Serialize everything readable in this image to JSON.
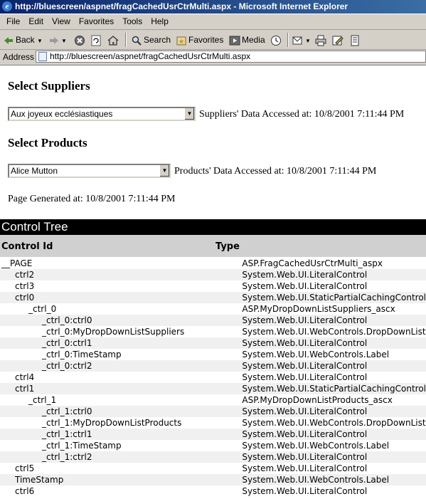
{
  "window": {
    "title": "http://bluescreen/aspnet/fragCachedUsrCtrMulti.aspx - Microsoft Internet Explorer"
  },
  "menu": [
    "File",
    "Edit",
    "View",
    "Favorites",
    "Tools",
    "Help"
  ],
  "toolbar": {
    "back": "Back",
    "search": "Search",
    "favorites": "Favorites",
    "media": "Media"
  },
  "address": {
    "label": "Address",
    "url": "http://bluescreen/aspnet/fragCachedUsrCtrMulti.aspx"
  },
  "page": {
    "suppliers_heading": "Select Suppliers",
    "suppliers_selected": "Aux joyeux ecclésiastiques",
    "suppliers_accessed": "Suppliers' Data Accessed at: 10/8/2001 7:11:44 PM",
    "products_heading": "Select Products",
    "products_selected": "Alice Mutton",
    "products_accessed": "Products' Data Accessed at: 10/8/2001 7:11:44 PM",
    "generated": "Page Generated at: 10/8/2001 7:11:44 PM"
  },
  "trace": {
    "title": "Control Tree",
    "col_id": "Control Id",
    "col_type": "Type",
    "rows": [
      {
        "id": "__PAGE",
        "indent": 0,
        "type": "ASP.FragCachedUsrCtrMulti_aspx"
      },
      {
        "id": "ctrl2",
        "indent": 1,
        "type": "System.Web.UI.LiteralControl"
      },
      {
        "id": "ctrl3",
        "indent": 1,
        "type": "System.Web.UI.LiteralControl"
      },
      {
        "id": "ctrl0",
        "indent": 1,
        "type": "System.Web.UI.StaticPartialCachingControl"
      },
      {
        "id": "_ctrl_0",
        "indent": 2,
        "type": "ASP.MyDropDownListSuppliers_ascx"
      },
      {
        "id": "_ctrl_0:ctrl0",
        "indent": 3,
        "type": "System.Web.UI.LiteralControl"
      },
      {
        "id": "_ctrl_0:MyDropDownListSuppliers",
        "indent": 3,
        "type": "System.Web.UI.WebControls.DropDownList"
      },
      {
        "id": "_ctrl_0:ctrl1",
        "indent": 3,
        "type": "System.Web.UI.LiteralControl"
      },
      {
        "id": "_ctrl_0:TimeStamp",
        "indent": 3,
        "type": "System.Web.UI.WebControls.Label"
      },
      {
        "id": "_ctrl_0:ctrl2",
        "indent": 3,
        "type": "System.Web.UI.LiteralControl"
      },
      {
        "id": "ctrl4",
        "indent": 1,
        "type": "System.Web.UI.LiteralControl"
      },
      {
        "id": "ctrl1",
        "indent": 1,
        "type": "System.Web.UI.StaticPartialCachingControl"
      },
      {
        "id": "_ctrl_1",
        "indent": 2,
        "type": "ASP.MyDropDownListProducts_ascx"
      },
      {
        "id": "_ctrl_1:ctrl0",
        "indent": 3,
        "type": "System.Web.UI.LiteralControl"
      },
      {
        "id": "_ctrl_1:MyDropDownListProducts",
        "indent": 3,
        "type": "System.Web.UI.WebControls.DropDownList"
      },
      {
        "id": "_ctrl_1:ctrl1",
        "indent": 3,
        "type": "System.Web.UI.LiteralControl"
      },
      {
        "id": "_ctrl_1:TimeStamp",
        "indent": 3,
        "type": "System.Web.UI.WebControls.Label"
      },
      {
        "id": "_ctrl_1:ctrl2",
        "indent": 3,
        "type": "System.Web.UI.LiteralControl"
      },
      {
        "id": "ctrl5",
        "indent": 1,
        "type": "System.Web.UI.LiteralControl"
      },
      {
        "id": "TimeStamp",
        "indent": 1,
        "type": "System.Web.UI.WebControls.Label"
      },
      {
        "id": "ctrl6",
        "indent": 1,
        "type": "System.Web.UI.LiteralControl"
      }
    ]
  },
  "icons": {
    "app": "ie-icon",
    "back": "back-arrow-icon",
    "forward": "forward-arrow-icon",
    "stop": "stop-icon",
    "refresh": "refresh-icon",
    "home": "home-icon",
    "search": "search-icon",
    "favorites": "favorites-icon",
    "media": "media-icon",
    "history": "history-icon",
    "mail": "mail-icon",
    "print": "print-icon",
    "edit": "edit-icon",
    "discuss": "discuss-icon"
  }
}
